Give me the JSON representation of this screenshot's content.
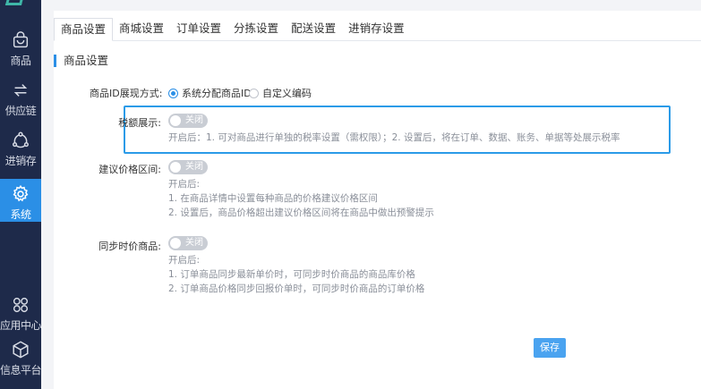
{
  "sidebar": {
    "items": [
      {
        "label": "商品",
        "icon": "shopping-bag-icon"
      },
      {
        "label": "供应链",
        "icon": "exchange-arrows-icon"
      },
      {
        "label": "进销存",
        "icon": "cycle-icon"
      },
      {
        "label": "系统",
        "icon": "gear-icon"
      },
      {
        "label": "应用中心",
        "icon": "apps-grid-icon"
      },
      {
        "label": "信息平台",
        "icon": "cube-icon"
      }
    ],
    "active_index": 3
  },
  "tabs": [
    {
      "label": "商品设置"
    },
    {
      "label": "商城设置"
    },
    {
      "label": "订单设置"
    },
    {
      "label": "分拣设置"
    },
    {
      "label": "配送设置"
    },
    {
      "label": "进销存设置"
    }
  ],
  "section_title": "商品设置",
  "product_id": {
    "label": "商品ID展现方式:",
    "option_system": "系统分配商品ID",
    "option_custom": "自定义编码",
    "selected": "系统分配商品ID"
  },
  "tax_display": {
    "label": "税额展示:",
    "switch_text": "关闭",
    "desc": "开启后：1. 可对商品进行单独的税率设置（需权限）；2. 设置后，将在订单、数据、账务、单据等处展示税率"
  },
  "price_range": {
    "label": "建议价格区间:",
    "switch_text": "关闭",
    "desc_title": "开启后:",
    "desc_1": "1. 在商品详情中设置每种商品的价格建议价格区间",
    "desc_2": "2. 设置后，商品价格超出建议价格区间将在商品中做出预警提示"
  },
  "sync_price": {
    "label": "同步时价商品:",
    "switch_text": "关闭",
    "desc_title": "开启后:",
    "desc_1": "1. 订单商品同步最新单价时，可同步时价商品的商品库价格",
    "desc_2": "2. 订单商品价格同步回报价单时，可同步时价商品的订单价格"
  },
  "save_label": "保存",
  "colors": {
    "sidebar_bg": "#1e2a4a",
    "accent": "#2b8fe6",
    "switch_off": "#c9cdd4"
  }
}
